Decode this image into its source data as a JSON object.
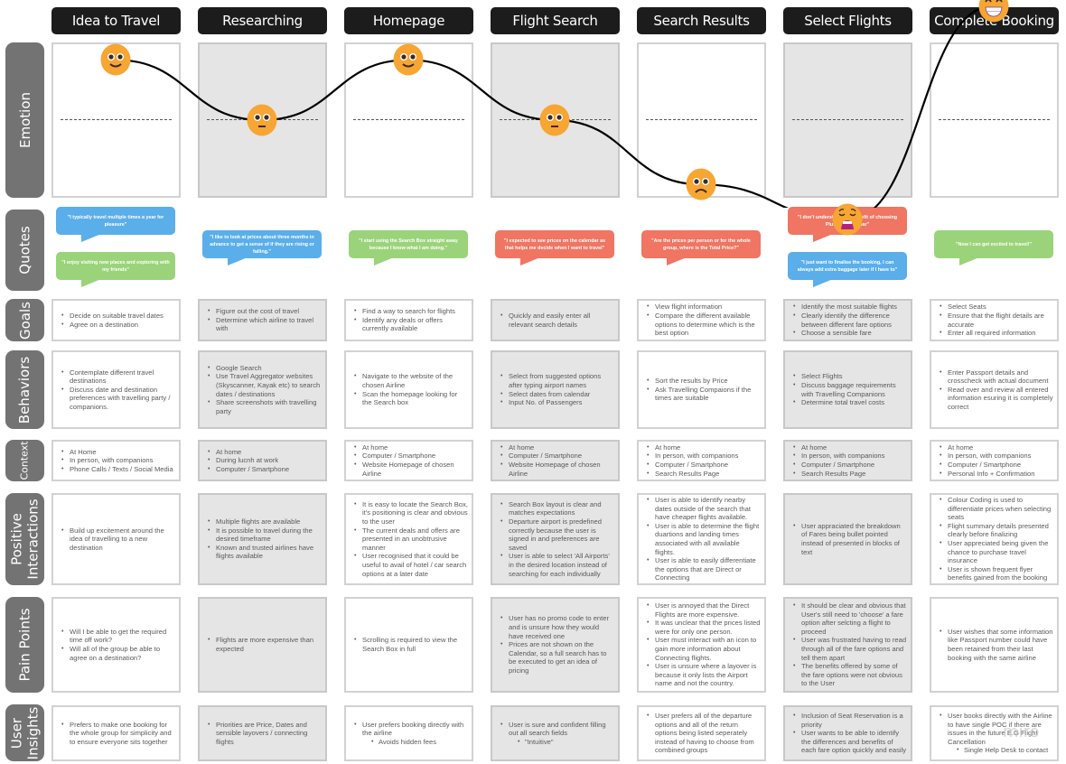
{
  "stages": [
    {
      "name": "Idea to Travel",
      "emotion": "happy"
    },
    {
      "name": "Researching",
      "emotion": "neutral"
    },
    {
      "name": "Homepage",
      "emotion": "happy"
    },
    {
      "name": "Flight Search",
      "emotion": "neutral"
    },
    {
      "name": "Search Results",
      "emotion": "sad"
    },
    {
      "name": "Select Flights",
      "emotion": "distressed"
    },
    {
      "name": "Complete Booking",
      "emotion": "grinning"
    }
  ],
  "row_labels": {
    "emotion": "Emotion",
    "quotes": "Quotes",
    "goals": "Goals",
    "behaviors": "Behaviors",
    "context": "Context",
    "positive_1": "Positive",
    "positive_2": "Interactions",
    "pain": "Pain Points",
    "insights_1": "User",
    "insights_2": "Insights"
  },
  "colors": {
    "quote_blue": "#5aaeea",
    "quote_green": "#9bd37a",
    "quote_red": "#f07562",
    "emoji": "#f7a533",
    "header": "#1c1c1c",
    "row_label": "#737373"
  },
  "quotes": [
    [
      {
        "text": "\"I typically travel multiple times a year for pleasure\"",
        "tone": "blue"
      },
      {
        "text": "\"I enjoy visiting new places and exploring with my friends\"",
        "tone": "green"
      }
    ],
    [
      {
        "text": "\"I like to look at prices about three months in advance to get a sense of if they are rising or falling.\"",
        "tone": "blue"
      }
    ],
    [
      {
        "text": "\"I start using the Search Box straight away because I know what I am doing.\"",
        "tone": "green"
      }
    ],
    [
      {
        "text": "\"I expected to see prices on the calendar as that helps me decide when I want to travel\"",
        "tone": "red"
      }
    ],
    [
      {
        "text": "\"Are the prices per person or for the whole group, where is the Total Price?\"",
        "tone": "red"
      }
    ],
    [
      {
        "text": "\"I don't understand the benefit of choosing Plus over Regular\"",
        "tone": "red"
      },
      {
        "text": "\"I just want to finalise the booking, I can always add extra baggage later if I have to\"",
        "tone": "blue"
      }
    ],
    [
      {
        "text": "\"Now I can get excited to travel!\"",
        "tone": "green"
      }
    ]
  ],
  "goals": [
    [
      "Decide on suitable travel dates",
      "Agree on a destination"
    ],
    [
      "Figure out the cost of travel",
      "Determine which airline to travel with"
    ],
    [
      "Find a way to search for flights",
      "Identify any deals or offers currently available"
    ],
    [
      "Quickly and easily enter all relevant search details"
    ],
    [
      "View flight information",
      "Compare the different available options to determine which is the best option"
    ],
    [
      "Identify the most suitable flights",
      "Clearly identify the difference between different fare options",
      "Choose a sensible fare"
    ],
    [
      "Select Seats",
      "Ensure that the flight details are accurate",
      "Enter all required information"
    ]
  ],
  "behaviors": [
    [
      "Contemplate different travel destinations",
      "Discuss date and destination preferences with travelling party / companions."
    ],
    [
      "Google Search",
      "Use Travel Aggregator websites (Skyscanner, Kayak etc) to search dates / destinations",
      "Share screenshots with travelling party"
    ],
    [
      "Navigate to the website of the chosen Airline",
      "Scan the homepage looking for the Search box"
    ],
    [
      "Select from suggested options after typing airport names",
      "Select dates from calendar",
      "Input No. of Passengers"
    ],
    [
      "Sort the results by Price",
      "Ask Travelling Compaions if the times are suitable"
    ],
    [
      "Select Flights",
      "Discuss baggage requirements with Travelling Companions",
      "Determine total travel costs"
    ],
    [
      "Enter Passport details and crosscheck with actual document",
      "Read over and review all entered information esuring it is completely correct"
    ]
  ],
  "context": [
    [
      "At Home",
      "In person, with companions",
      "Phone Calls / Texts / Social Media"
    ],
    [
      "At home",
      "During lucnh at work",
      "Computer / Smartphone"
    ],
    [
      "At home",
      "Computer / Smartphone",
      "Website Homepage of chosen Airline"
    ],
    [
      "At home",
      "Computer / Smartphone",
      "Website Homepage of chosen Airline"
    ],
    [
      "At home",
      "In person, with companions",
      "Computer / Smartphone",
      "Search Results Page"
    ],
    [
      "At home",
      "In person, with companions",
      "Computer / Smartphone",
      "Search Results Page"
    ],
    [
      "At home",
      "In person, with companions",
      "Computer / Smartphone",
      "Personal Info + Confirmation"
    ]
  ],
  "positive_interactions": [
    [
      "Build up excitement around the idea of travelling to a new destination"
    ],
    [
      "Multiple flights are available",
      "It is possible to travel during the desired timeframe",
      "Known and trusted airlines have flights available"
    ],
    [
      "It is easy to locate the Search Box, it's positioning is clear and obvious to the user",
      "The current deals and offers are presented in an unobtrusive manner",
      "User recognised that it could be useful to avail of hotel / car search options at a later date"
    ],
    [
      "Search Box layout is clear and matches expectations",
      "Departure airport is predefined correctly because the user is signed in and preferences are saved",
      "User is able to select 'All Airports' in the desired location instead of searching for each individually"
    ],
    [
      "User is able to identify nearby dates outside of the search that have cheaper flights available.",
      "User is able to determine the flight duartions and landing times associated with all available flights.",
      "User is able to easily differentiate the options that are Direct or Connecting"
    ],
    [
      "User appraciated the breakdown of Fares being bullet pointed instead of presented in blocks of text"
    ],
    [
      "Colour Coding is used to differentiate prices when selecting seats",
      "Flight summary details presented clearly before finalizing",
      "User appreciated being given the chance to purchase travel insurance",
      "User is shown frequent flyer benefits gained from the booking"
    ]
  ],
  "pain_points": [
    [
      "Will I be able to get the required time off work?",
      "Will all of the group be able to agree on a destination?"
    ],
    [
      "Flights are more expensive than expected"
    ],
    [
      "Scrolling is required to view the Search Box in full"
    ],
    [
      "User has no promo code to enter and is unsure how they would have received one",
      "Prices are not shown on the Calendar, so a full search has to be executed to get an idea of pricing"
    ],
    [
      "User is annoyed that the Direct Flights are more expensive.",
      "It was unclear that the prices listed were for only one person.",
      "User must interact with an icon to gain more information about Connecting flights.",
      "User is unsure where a layover is because it only lists the Airport name and not the country."
    ],
    [
      "It should be clear and obvious that User's still need to 'choose' a fare option after selcting a flight to proceed",
      "User was frustrated having to read through all of the fare options and tell them apart",
      "The benefits offered by some of the fare options were not obvious to the User"
    ],
    [
      "User wishes that some information like Passport number could have been retained from their last booking with the same airline"
    ]
  ],
  "user_insights": [
    [
      {
        "t": "Prefers to make one booking for the whole group for simplicity and to ensure everyone sits together"
      }
    ],
    [
      {
        "t": "Priorities are Price, Dates and sensible layovers / connecting flights"
      }
    ],
    [
      {
        "t": "User prefers booking directly with the airline"
      },
      {
        "t": "Avoids hidden fees",
        "sub": true
      }
    ],
    [
      {
        "t": "User is sure and confident filling out all search fields"
      },
      {
        "t": "\"Intuitive\"",
        "sub": true
      }
    ],
    [
      {
        "t": "User prefers all of the departure options and all of the return options being listed seperately instead of having to choose from combined groups"
      }
    ],
    [
      {
        "t": "Inclusion of Seat Reservation is a priority"
      },
      {
        "t": "User wants to be able to identify the differences and benefits of each fare option quickly and easily"
      }
    ],
    [
      {
        "t": "User books directly with the Airline to have single POC if there are issues in the future E.G Flight Cancellation"
      },
      {
        "t": "Single Help Desk to contact",
        "sub": true
      }
    ]
  ],
  "emotion_levels": [
    0.72,
    0.43,
    0.72,
    0.43,
    0.12,
    -0.05,
    0.98
  ],
  "watermark": "miro"
}
